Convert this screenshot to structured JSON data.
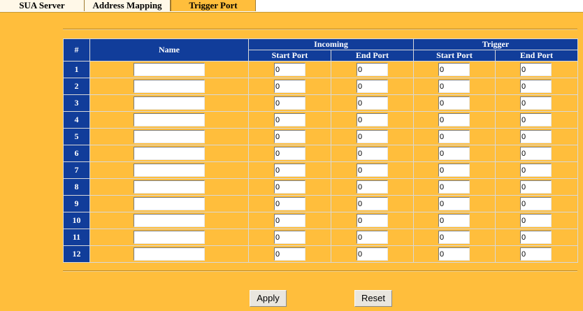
{
  "tabs": [
    {
      "label": "SUA Server",
      "active": false
    },
    {
      "label": "Address Mapping",
      "active": false
    },
    {
      "label": "Trigger Port",
      "active": true
    }
  ],
  "table": {
    "headers": {
      "num": "#",
      "name": "Name",
      "incoming": "Incoming",
      "trigger": "Trigger",
      "start_port": "Start Port",
      "end_port": "End Port"
    },
    "rows": [
      {
        "num": "1",
        "name": "",
        "in_start": "0",
        "in_end": "0",
        "trig_start": "0",
        "trig_end": "0"
      },
      {
        "num": "2",
        "name": "",
        "in_start": "0",
        "in_end": "0",
        "trig_start": "0",
        "trig_end": "0"
      },
      {
        "num": "3",
        "name": "",
        "in_start": "0",
        "in_end": "0",
        "trig_start": "0",
        "trig_end": "0"
      },
      {
        "num": "4",
        "name": "",
        "in_start": "0",
        "in_end": "0",
        "trig_start": "0",
        "trig_end": "0"
      },
      {
        "num": "5",
        "name": "",
        "in_start": "0",
        "in_end": "0",
        "trig_start": "0",
        "trig_end": "0"
      },
      {
        "num": "6",
        "name": "",
        "in_start": "0",
        "in_end": "0",
        "trig_start": "0",
        "trig_end": "0"
      },
      {
        "num": "7",
        "name": "",
        "in_start": "0",
        "in_end": "0",
        "trig_start": "0",
        "trig_end": "0"
      },
      {
        "num": "8",
        "name": "",
        "in_start": "0",
        "in_end": "0",
        "trig_start": "0",
        "trig_end": "0"
      },
      {
        "num": "9",
        "name": "",
        "in_start": "0",
        "in_end": "0",
        "trig_start": "0",
        "trig_end": "0"
      },
      {
        "num": "10",
        "name": "",
        "in_start": "0",
        "in_end": "0",
        "trig_start": "0",
        "trig_end": "0"
      },
      {
        "num": "11",
        "name": "",
        "in_start": "0",
        "in_end": "0",
        "trig_start": "0",
        "trig_end": "0"
      },
      {
        "num": "12",
        "name": "",
        "in_start": "0",
        "in_end": "0",
        "trig_start": "0",
        "trig_end": "0"
      }
    ]
  },
  "buttons": {
    "apply": "Apply",
    "reset": "Reset"
  },
  "colors": {
    "background": "#ffbe3c",
    "header": "#113d9a"
  }
}
